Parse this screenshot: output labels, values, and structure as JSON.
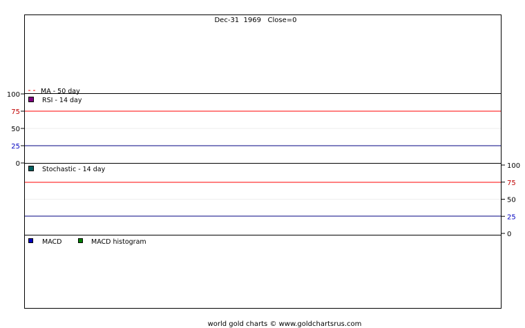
{
  "header": {
    "text": "Dec-31  1969   Close=0"
  },
  "footer": {
    "text": "world gold charts © www.goldchartsrus.com"
  },
  "colors": {
    "frame": "#000000",
    "overbought": "#ff0000",
    "oversold": "#000080",
    "tick_red": "#c00000",
    "tick_blue": "#0000c0",
    "grid": "#eeeeee",
    "rsi_swatch": "#800080",
    "stoch_swatch": "#006060",
    "macd_swatch": "#0000c0",
    "macd_hist_swatch": "#008000",
    "ma_dash": "#ff0000"
  },
  "chart_data": [
    {
      "panel": "price",
      "type": "line",
      "series": [
        {
          "name": "MA - 50 day",
          "values": []
        }
      ]
    },
    {
      "panel": "rsi",
      "type": "line",
      "series": [
        {
          "name": "RSI - 14 day",
          "values": []
        }
      ],
      "ylim": [
        0,
        100
      ],
      "yticks": [
        "100",
        "75",
        "50",
        "25",
        "0"
      ],
      "reference_lines": [
        75,
        25
      ],
      "axis_side": "left"
    },
    {
      "panel": "stochastic",
      "type": "line",
      "series": [
        {
          "name": "Stochastic - 14 day",
          "values": []
        }
      ],
      "ylim": [
        0,
        100
      ],
      "yticks": [
        "100",
        "75",
        "50",
        "25",
        "0"
      ],
      "reference_lines": [
        75,
        25
      ],
      "axis_side": "right"
    },
    {
      "panel": "macd",
      "type": "line",
      "series": [
        {
          "name": "MACD",
          "values": []
        },
        {
          "name": "MACD histogram",
          "values": []
        }
      ]
    }
  ]
}
